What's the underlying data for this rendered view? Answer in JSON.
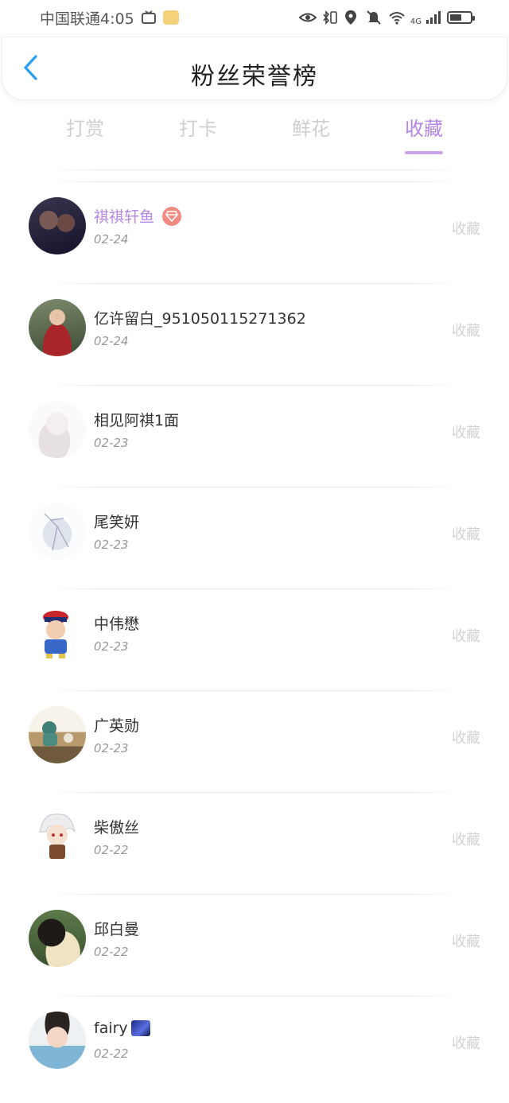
{
  "status_bar": {
    "carrier_time": "中国联通4:05",
    "network": "4G"
  },
  "header": {
    "title": "粉丝荣誉榜",
    "back_icon": "chevron-left-icon"
  },
  "tabs": [
    {
      "label": "打赏",
      "active": false
    },
    {
      "label": "打卡",
      "active": false
    },
    {
      "label": "鲜花",
      "active": false
    },
    {
      "label": "收藏",
      "active": true
    }
  ],
  "rows": [
    {
      "name": "祺祺轩鱼",
      "date": "02-24",
      "action": "收藏",
      "highlight": true,
      "badge": "diamond-icon"
    },
    {
      "name": "亿许留白_951050115271362",
      "date": "02-24",
      "action": "收藏"
    },
    {
      "name": "相见阿祺1面",
      "date": "02-23",
      "action": "收藏"
    },
    {
      "name": "尾笑妍",
      "date": "02-23",
      "action": "收藏"
    },
    {
      "name": "中伟懋",
      "date": "02-23",
      "action": "收藏"
    },
    {
      "name": "广英勋",
      "date": "02-23",
      "action": "收藏"
    },
    {
      "name": "柴傲丝",
      "date": "02-22",
      "action": "收藏"
    },
    {
      "name": "邱白曼",
      "date": "02-22",
      "action": "收藏"
    },
    {
      "name": "fairy",
      "date": "02-22",
      "action": "收藏"
    }
  ],
  "colors": {
    "accent": "#b487e4",
    "inactive_tab": "#cfcfcf",
    "action_text": "#d2d2d2",
    "back_arrow": "#2a9df4",
    "badge": "#f28b82"
  }
}
